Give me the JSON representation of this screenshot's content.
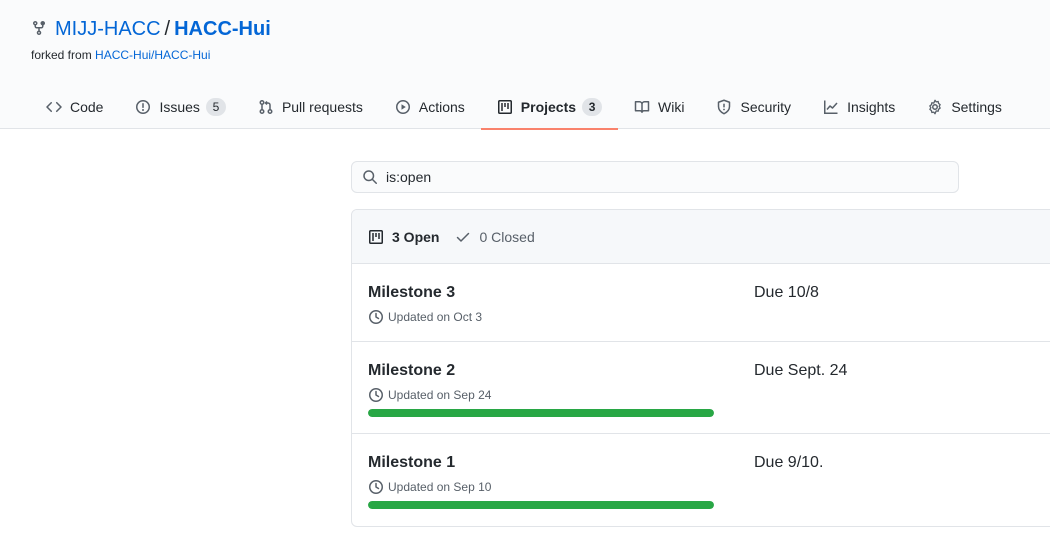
{
  "repo": {
    "owner": "MIJJ-HACC",
    "separator": "/",
    "name": "HACC-Hui",
    "forked_prefix": "forked from",
    "forked_source": "HACC-Hui/HACC-Hui"
  },
  "tabs": [
    {
      "label": "Code",
      "icon": "code-icon"
    },
    {
      "label": "Issues",
      "icon": "issue-icon",
      "counter": "5"
    },
    {
      "label": "Pull requests",
      "icon": "pull-request-icon"
    },
    {
      "label": "Actions",
      "icon": "play-icon"
    },
    {
      "label": "Projects",
      "icon": "project-icon",
      "counter": "3",
      "selected": true
    },
    {
      "label": "Wiki",
      "icon": "book-icon"
    },
    {
      "label": "Security",
      "icon": "shield-icon"
    },
    {
      "label": "Insights",
      "icon": "graph-icon"
    },
    {
      "label": "Settings",
      "icon": "gear-icon"
    }
  ],
  "search": {
    "value": "is:open"
  },
  "states": {
    "open": "3 Open",
    "closed": "0 Closed"
  },
  "projects": [
    {
      "name": "Milestone 3",
      "updated": "Updated on Oct 3",
      "description": "Due 10/8"
    },
    {
      "name": "Milestone 2",
      "updated": "Updated on Sep 24",
      "description": "Due Sept. 24",
      "progress": 1.0
    },
    {
      "name": "Milestone 1",
      "updated": "Updated on Sep 10",
      "description": "Due 9/10.",
      "progress": 1.0
    }
  ],
  "colors": {
    "link": "#0366d6",
    "selected_tab_underline": "#f9826c",
    "progress_fill": "#28a745"
  }
}
